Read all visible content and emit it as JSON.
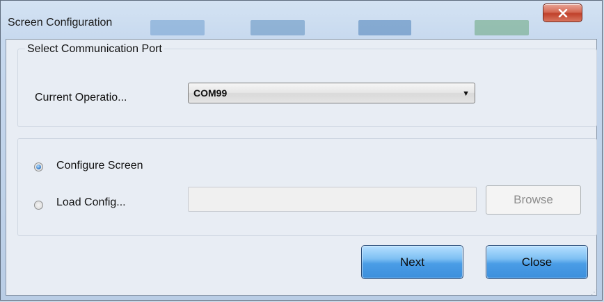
{
  "window": {
    "title": "Screen Configuration",
    "close_glyph": "✕"
  },
  "port_group": {
    "legend": "Select Communication Port",
    "current_operation_label": "Current Operatio...",
    "combo_value": "COM99",
    "combo_arrow": "▼"
  },
  "options": {
    "configure_screen_label": "Configure Screen",
    "configure_screen_checked": true,
    "load_config_label": "Load Config...",
    "load_config_checked": false,
    "load_config_path": "",
    "browse_label": "Browse"
  },
  "footer": {
    "next_label": "Next",
    "close_label": "Close",
    "resize_grip": "⋰"
  },
  "colors": {
    "accent_button": "#4a9de6",
    "title_close": "#c0412b"
  },
  "icons": {
    "window_close": "close-icon",
    "dropdown": "chevron-down-icon",
    "grip": "resize-grip-icon"
  }
}
